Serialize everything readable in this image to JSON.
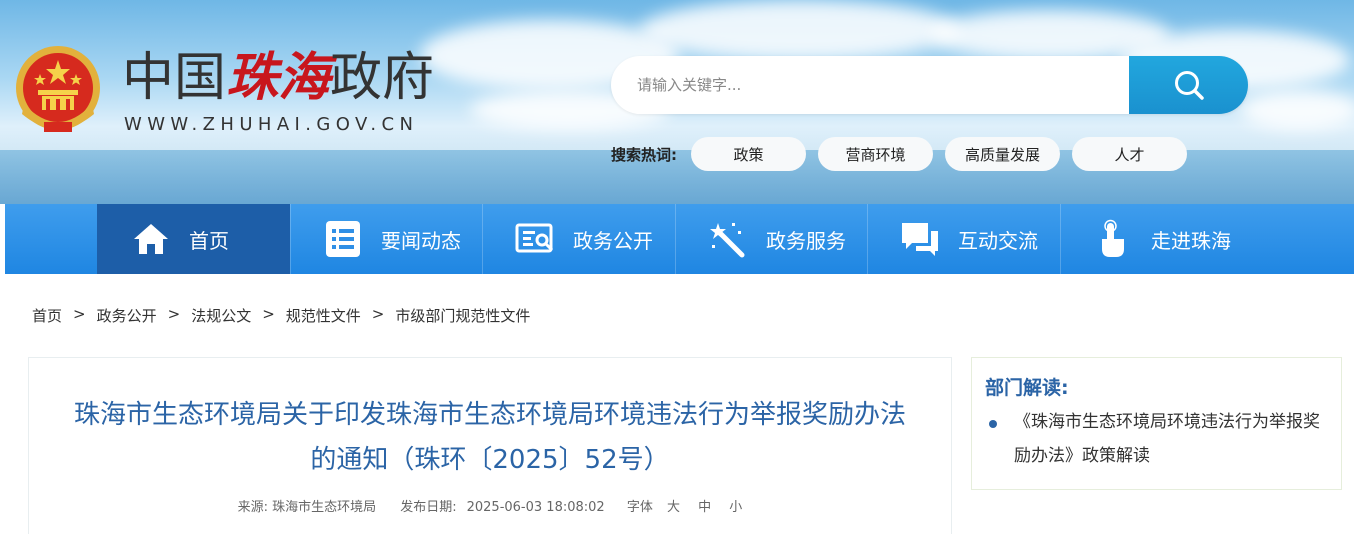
{
  "header": {
    "site_title_part1": "中国",
    "site_title_part2": "珠海",
    "site_title_part3": "政府",
    "site_url": "WWW.ZHUHAI.GOV.CN",
    "search_placeholder": "请输入关键字...",
    "hot_label": "搜索热词:",
    "hot_terms": [
      "政策",
      "营商环境",
      "高质量发展",
      "人才"
    ]
  },
  "nav": {
    "items": [
      {
        "label": "首页",
        "icon": "home-icon"
      },
      {
        "label": "要闻动态",
        "icon": "news-list-icon"
      },
      {
        "label": "政务公开",
        "icon": "document-search-icon"
      },
      {
        "label": "政务服务",
        "icon": "magic-wand-icon"
      },
      {
        "label": "互动交流",
        "icon": "chat-bubbles-icon"
      },
      {
        "label": "走进珠海",
        "icon": "hand-pointer-icon"
      }
    ]
  },
  "breadcrumb": [
    "首页",
    "政务公开",
    "法规公文",
    "规范性文件",
    "市级部门规范性文件"
  ],
  "breadcrumb_sep": ">",
  "article": {
    "title_line1": "珠海市生态环境局关于印发珠海市生态环境局环境违法行为举报奖励办法",
    "title_line2": "的通知（珠环〔2025〕52号）",
    "source_label": "来源:",
    "source": "珠海市生态环境局",
    "date_label": "发布日期:",
    "date": "2025-06-03 18:08:02",
    "font_label": "字体",
    "font_large": "大",
    "font_medium": "中",
    "font_small": "小"
  },
  "sidebar": {
    "title": "部门解读:",
    "items": [
      "《珠海市生态环境局环境违法行为举报奖励办法》政策解读"
    ]
  },
  "colors": {
    "nav_blue": "#1f86e2",
    "nav_active": "#1d5ea8",
    "title_blue": "#2b64a6",
    "brand_red": "#c8161d",
    "search_button": "#1a91cf"
  }
}
